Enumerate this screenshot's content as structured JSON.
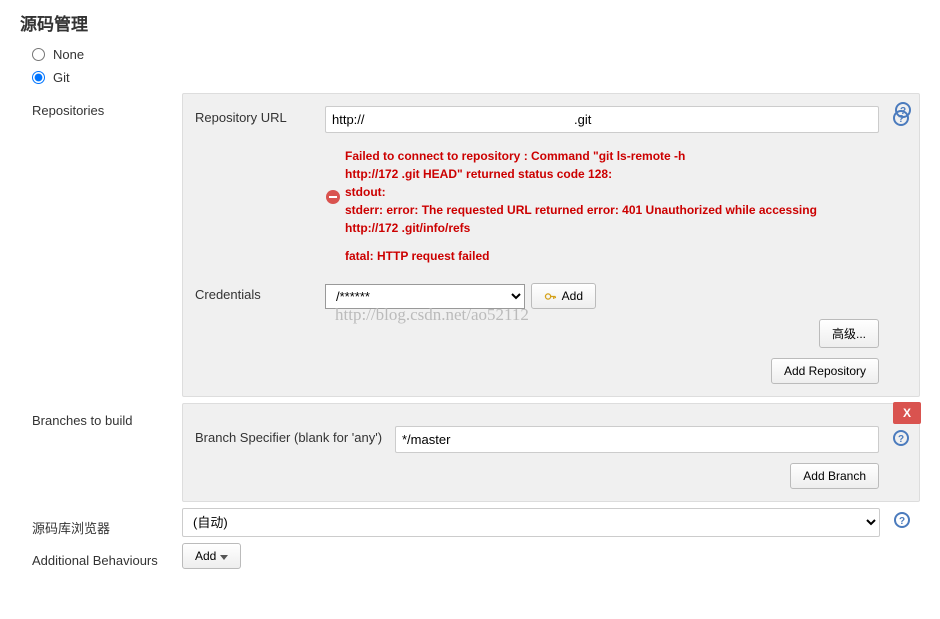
{
  "section_title": "源码管理",
  "scm": {
    "none_label": "None",
    "git_label": "Git"
  },
  "repositories": {
    "label": "Repositories",
    "url_label": "Repository URL",
    "url_value": "http://                                                          .git",
    "error_l1": "Failed to connect to repository : Command \"git ls-remote -h",
    "error_l2": "http://172                                                         .git HEAD\" returned status code 128:",
    "error_l3": "stdout:",
    "error_l4": "stderr: error: The requested URL returned error: 401 Unauthorized while accessing",
    "error_l5": "http://172                                                       .git/info/refs",
    "error_l6": "fatal: HTTP request failed",
    "cred_label": "Credentials",
    "cred_value": "                 /******",
    "add_cred_label": " Add",
    "advanced_label": "高级...",
    "add_repo_label": "Add Repository"
  },
  "branches": {
    "label": "Branches to build",
    "specifier_label": "Branch Specifier (blank for 'any')",
    "specifier_value": "*/master",
    "delete_label": "X",
    "add_branch_label": "Add Branch"
  },
  "browser": {
    "label": "源码库浏览器",
    "value": "(自动)"
  },
  "behaviours": {
    "label": "Additional Behaviours",
    "add_label": "Add"
  },
  "watermark": "http://blog.csdn.net/ao52112"
}
